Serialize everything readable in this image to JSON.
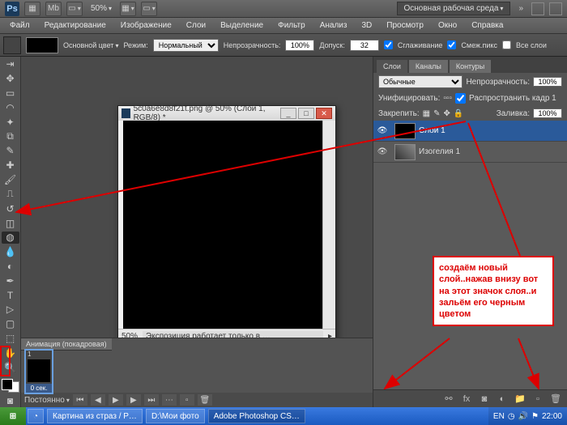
{
  "topbar": {
    "logo": "Ps",
    "zoom": "50%",
    "workspace": "Основная рабочая среда"
  },
  "menu": [
    "Файл",
    "Редактирование",
    "Изображение",
    "Слои",
    "Выделение",
    "Фильтр",
    "Анализ",
    "3D",
    "Просмотр",
    "Окно",
    "Справка"
  ],
  "options": {
    "swatch_label": "Основной цвет",
    "mode_label": "Режим:",
    "mode_value": "Нормальный",
    "opacity_label": "Непрозрачность:",
    "opacity_value": "100%",
    "tolerance_label": "Допуск:",
    "tolerance_value": "32",
    "antialias": "Сглаживание",
    "contiguous": "Смеж.пикс",
    "all_layers": "Все слои"
  },
  "document": {
    "title": "5c0a6e8d8f21t.png @ 50% (Слой 1, RGB/8) *",
    "zoom": "50%",
    "status": "Экспозиция работает только в …"
  },
  "animation": {
    "title": "Анимация (покадровая)",
    "frame_num": "1",
    "frame_time": "0 сек.",
    "loop": "Постоянно"
  },
  "layers_panel": {
    "tabs": [
      "Слои",
      "Каналы",
      "Контуры"
    ],
    "blend_mode": "Обычные",
    "opacity_label": "Непрозрачность:",
    "opacity_value": "100%",
    "unify_label": "Унифицировать:",
    "propagate": "Распространить кадр 1",
    "lock_label": "Закрепить:",
    "fill_label": "Заливка:",
    "fill_value": "100%",
    "layers": [
      {
        "name": "Слой 1",
        "selected": true
      },
      {
        "name": "Изогелия 1",
        "selected": false
      }
    ]
  },
  "annotation": "создаём новый слой..нажав внизу вот на этот значок слоя..и зальём его черным цветом",
  "taskbar": {
    "items": [
      "",
      "Картина из страз / Р…",
      "D:\\Мои фото",
      "Adobe Photoshop CS…"
    ],
    "lang": "EN",
    "time": "22:00"
  }
}
